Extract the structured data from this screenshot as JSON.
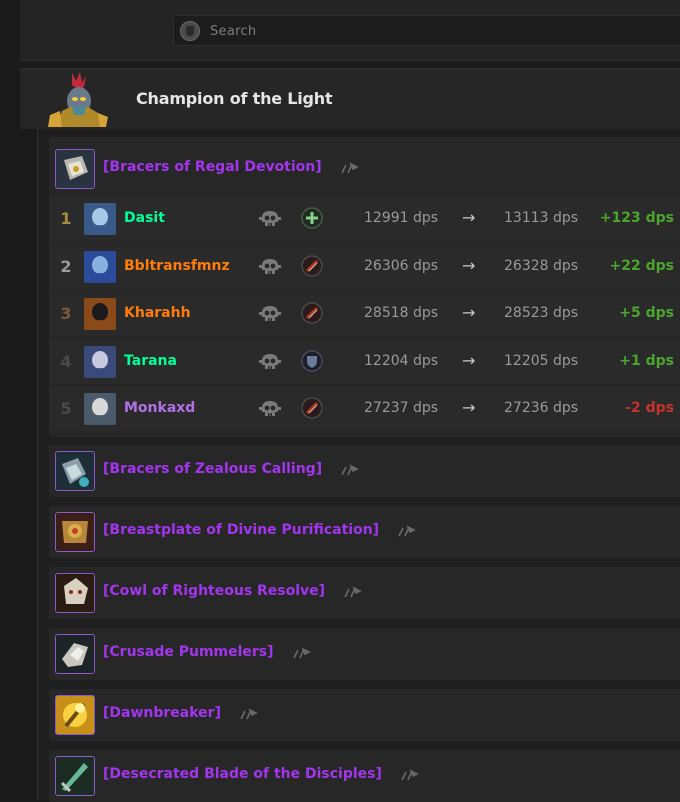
{
  "search": {
    "placeholder": "Search"
  },
  "header": {
    "title": "Champion of the Light"
  },
  "expanded_item": {
    "name": "[Bracers of Regal Devotion]",
    "rows": [
      {
        "rank": "1",
        "rank_color": "#a58e3c",
        "player": "Dasit",
        "player_color": "#00ff96",
        "spec": "restoration",
        "dps_before": "12991 dps",
        "dps_after": "13113 dps",
        "delta": "+123 dps",
        "delta_color": "#4ba52d"
      },
      {
        "rank": "2",
        "rank_color": "#9c9c9c",
        "player": "Bbltransfmnz",
        "player_color": "#ff7c0a",
        "spec": "feral",
        "dps_before": "26306 dps",
        "dps_after": "26328 dps",
        "delta": "+22 dps",
        "delta_color": "#4ba52d"
      },
      {
        "rank": "3",
        "rank_color": "#7a5a3a",
        "player": "Kharahh",
        "player_color": "#ff7c0a",
        "spec": "feral",
        "dps_before": "28518 dps",
        "dps_after": "28523 dps",
        "delta": "+5 dps",
        "delta_color": "#4ba52d"
      },
      {
        "rank": "4",
        "rank_color": "#4a4a4a",
        "player": "Tarana",
        "player_color": "#00ff96",
        "spec": "protection",
        "dps_before": "12204 dps",
        "dps_after": "12205 dps",
        "delta": "+1 dps",
        "delta_color": "#4ba52d"
      },
      {
        "rank": "5",
        "rank_color": "#4a4a4a",
        "player": "Monkaxd",
        "player_color": "#b072e6",
        "spec": "feral",
        "dps_before": "27237 dps",
        "dps_after": "27236 dps",
        "delta": "-2 dps",
        "delta_color": "#c8322d"
      }
    ],
    "arrow": "→"
  },
  "items": [
    {
      "name": "[Bracers of Zealous Calling]",
      "icon": "bracers-icon"
    },
    {
      "name": "[Breastplate of Divine Purification]",
      "icon": "breastplate-icon"
    },
    {
      "name": "[Cowl of Righteous Resolve]",
      "icon": "cowl-icon"
    },
    {
      "name": "[Crusade Pummelers]",
      "icon": "gauntlets-icon"
    },
    {
      "name": "[Dawnbreaker]",
      "icon": "dawnbreaker-icon"
    },
    {
      "name": "[Desecrated Blade of the Disciples]",
      "icon": "blade-icon"
    }
  ],
  "colors": {
    "epic": "#a335ee",
    "background": "#1a1a1a",
    "card": "#272727"
  }
}
